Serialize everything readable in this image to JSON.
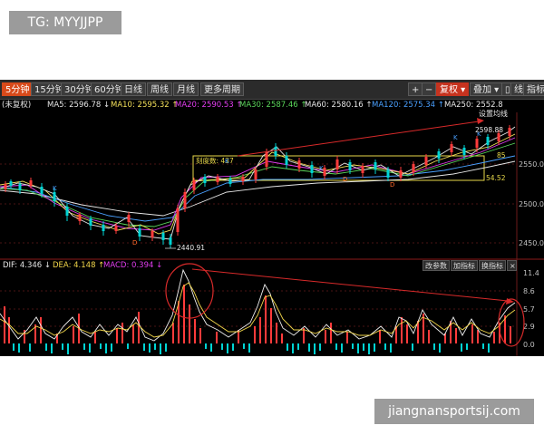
{
  "watermark_top": "TG: MYYJJPP",
  "watermark_bottom": "jiangnansportsij.com",
  "toolbar": {
    "timeframes": [
      "5分钟",
      "15分钟",
      "30分钟",
      "60分钟",
      "日线",
      "周线",
      "月线",
      "更多周期"
    ],
    "active_index": 0,
    "right_buttons": [
      "+",
      "−",
      "复权 ▾",
      "叠加 ▾",
      "▯",
      "线",
      "指标"
    ]
  },
  "ma_bar": {
    "title": "(未复权)",
    "items": [
      {
        "label": "MA5: 2596.78 ↓",
        "color": "#e6e6e6"
      },
      {
        "label": "MA10: 2595.32 ↑",
        "color": "#f3e05a"
      },
      {
        "label": "MA20: 2590.53 ↑",
        "color": "#e23df0"
      },
      {
        "label": "MA30: 2587.46 ↑",
        "color": "#5ad65a"
      },
      {
        "label": "MA60: 2580.16 ↑",
        "color": "#e6e6e6"
      },
      {
        "label": "MA120: 2575.34 ↑",
        "color": "#4aa0ff"
      },
      {
        "label": "MA250: 2552.8",
        "color": "#e6e6e6"
      }
    ],
    "settings": "设置均线"
  },
  "price_axis": [
    "2550.00",
    "2500.00",
    "2450.00"
  ],
  "annotations": {
    "high": "2598.88",
    "low": "2440.91",
    "box_label": "刻度数: 437",
    "box_low": "54.52",
    "tag_85": "85"
  },
  "macd": {
    "dif": "DIF: 4.346 ↓",
    "dea": "DEA: 4.148 ↑",
    "macd": "MACD: 0.394 ↓",
    "buttons": [
      "改参数",
      "加指标",
      "换指标"
    ],
    "axis": [
      "11.4",
      "8.6",
      "5.7",
      "2.9",
      "0.0"
    ]
  },
  "colors": {
    "up": "#ff3b3b",
    "down": "#00d4d4",
    "box": "#e8d94a",
    "trend": "#d82a2a",
    "fast": "#f0f0f0",
    "slow": "#f1d64a"
  }
}
